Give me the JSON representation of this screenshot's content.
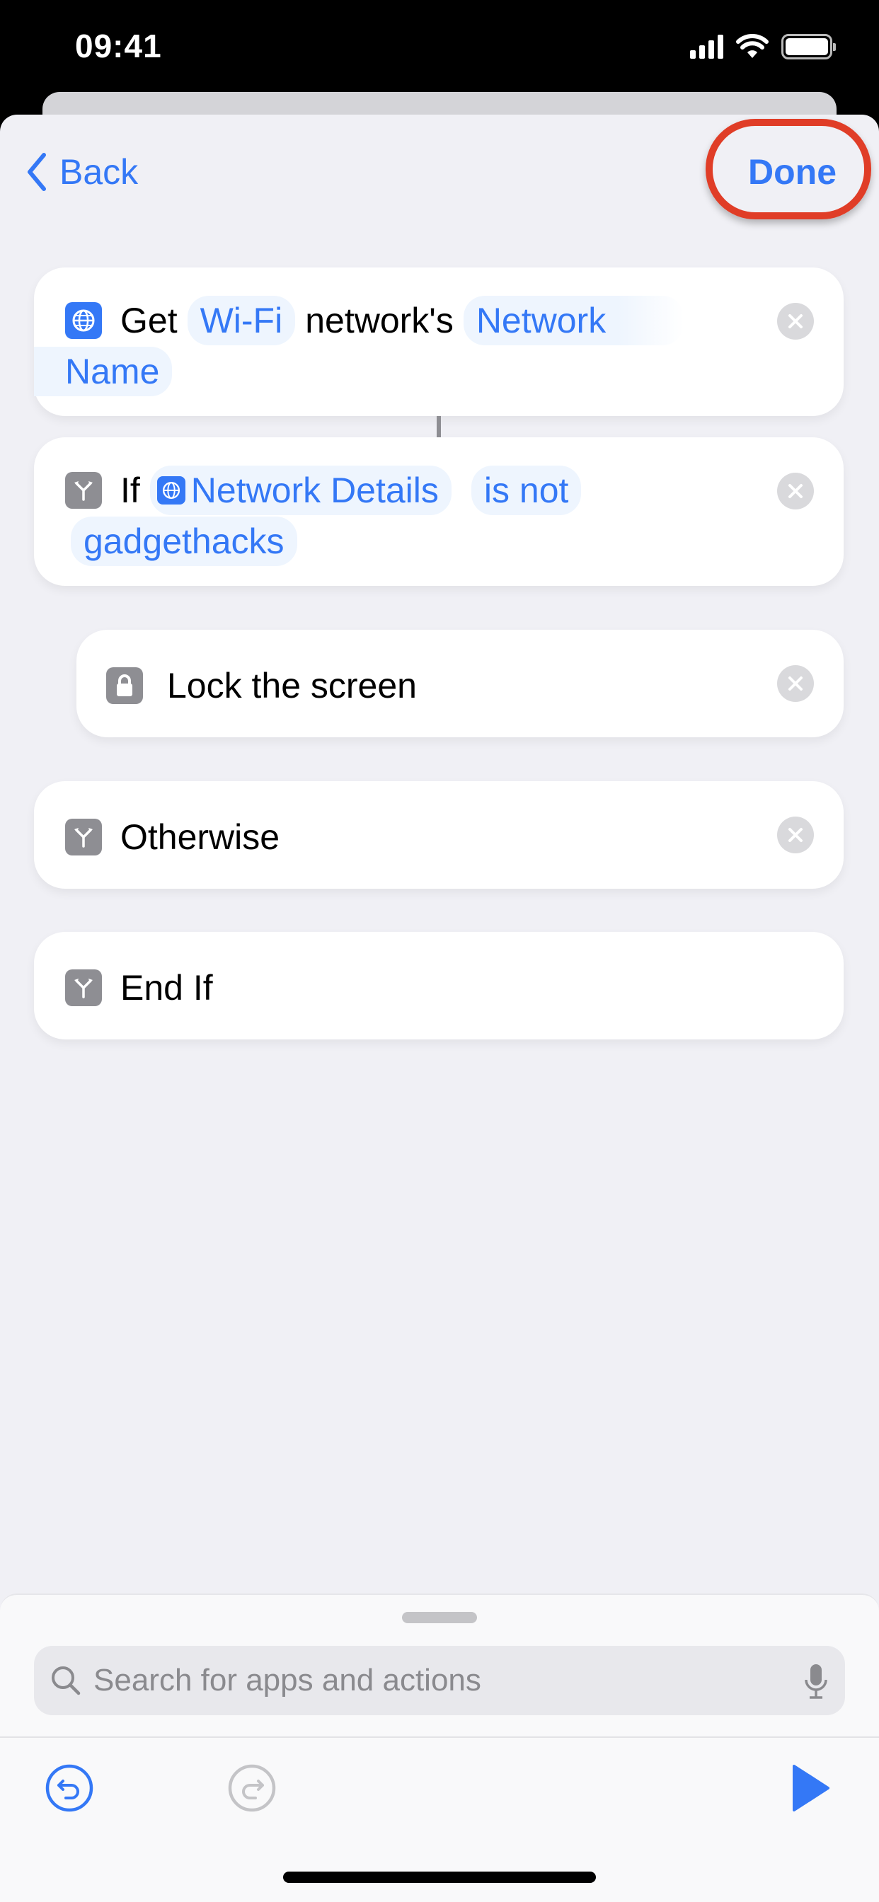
{
  "status_bar": {
    "time": "09:41",
    "icons": [
      "cellular-signal-icon",
      "wifi-icon",
      "battery-icon"
    ]
  },
  "nav": {
    "back_label": "Back",
    "done_label": "Done",
    "done_highlighted": true,
    "highlight_color": "#e03d27"
  },
  "colors": {
    "accent": "#3478f6",
    "background": "#f0f0f5",
    "card": "#ffffff",
    "scripting_icon": "#8e8e93"
  },
  "actions": [
    {
      "type": "get-network-details",
      "icon": "globe-icon",
      "parts": [
        {
          "kind": "text",
          "value": "Get"
        },
        {
          "kind": "token",
          "value": "Wi-Fi"
        },
        {
          "kind": "text",
          "value": "network's"
        },
        {
          "kind": "token",
          "value": "Network Name"
        }
      ],
      "removable": true
    },
    {
      "type": "if",
      "icon": "branch-icon",
      "parts": [
        {
          "kind": "text",
          "value": "If"
        },
        {
          "kind": "variable",
          "value": "Network Details",
          "icon": "globe-icon"
        },
        {
          "kind": "token",
          "value": "is not"
        },
        {
          "kind": "token",
          "value": "gadgethacks"
        }
      ],
      "removable": true
    },
    {
      "type": "lock-screen",
      "icon": "lock-icon",
      "label": "Lock the screen",
      "indented": true,
      "removable": true
    },
    {
      "type": "otherwise",
      "icon": "branch-icon",
      "label": "Otherwise",
      "removable": true
    },
    {
      "type": "end-if",
      "icon": "branch-icon",
      "label": "End If",
      "removable": false
    }
  ],
  "bottom_panel": {
    "search_placeholder": "Search for apps and actions",
    "search_value": "",
    "undo_enabled": true,
    "redo_enabled": false
  }
}
